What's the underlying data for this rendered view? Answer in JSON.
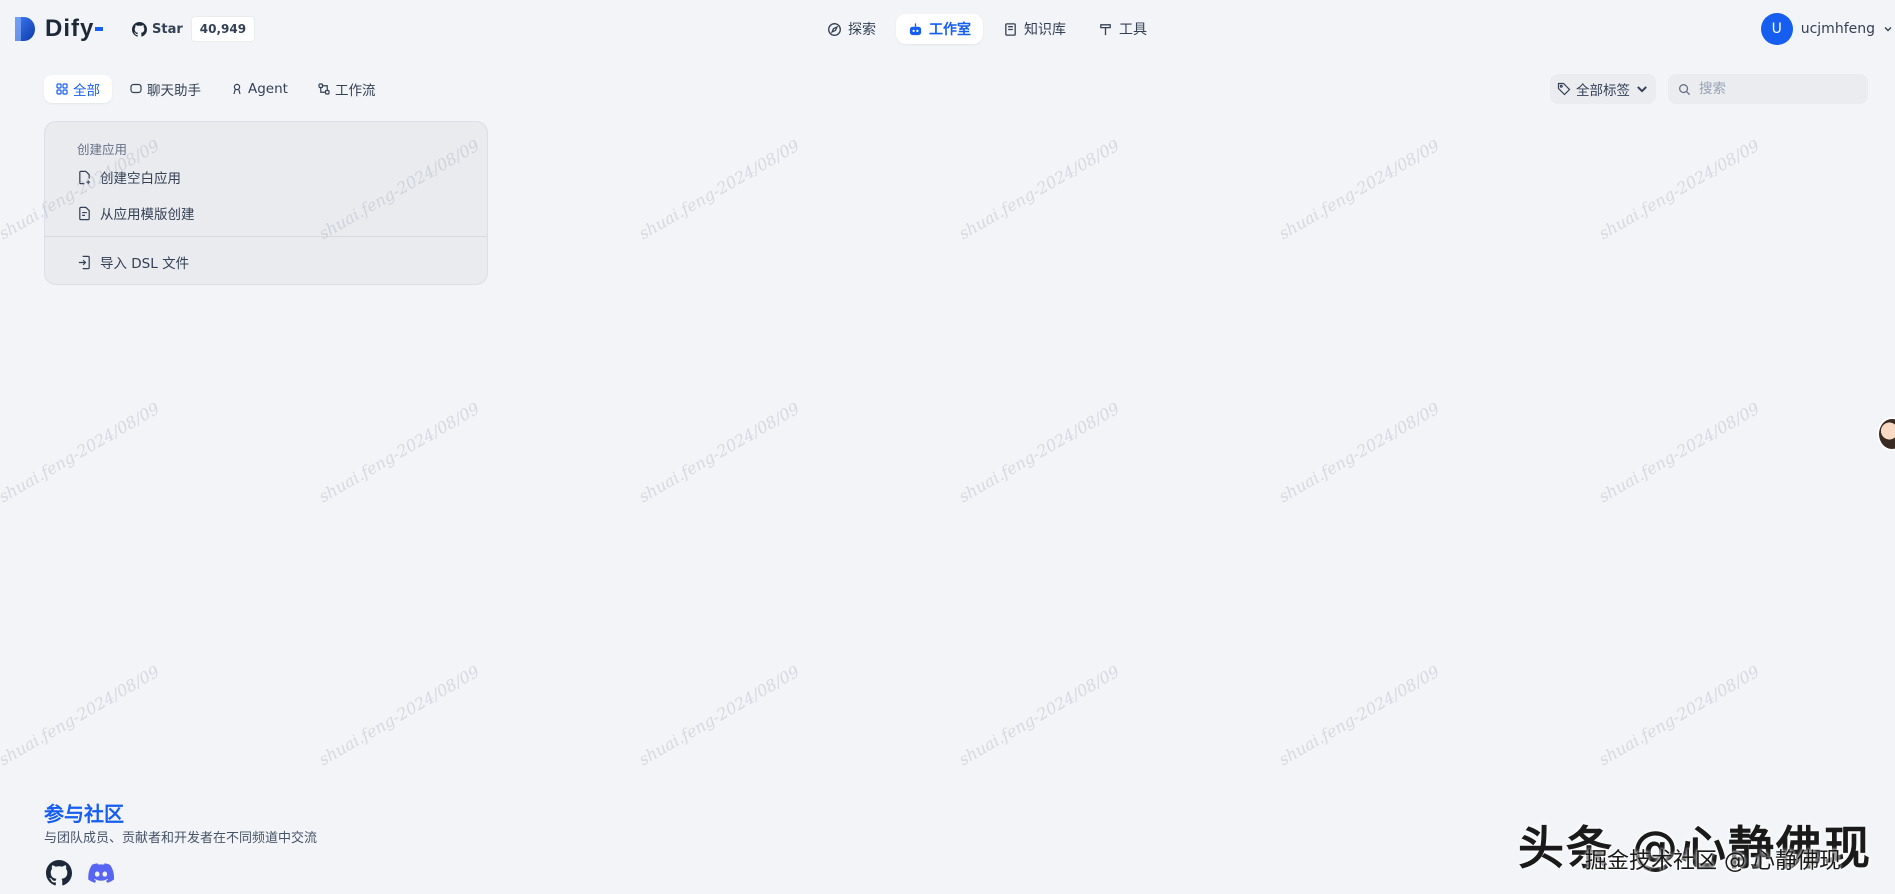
{
  "brand": {
    "name": "Dify"
  },
  "github": {
    "label": "Star",
    "count": "40,949"
  },
  "nav": {
    "items": [
      {
        "label": "探索",
        "icon": "compass-icon",
        "active": false
      },
      {
        "label": "工作室",
        "icon": "robot-icon",
        "active": true
      },
      {
        "label": "知识库",
        "icon": "book-icon",
        "active": false
      },
      {
        "label": "工具",
        "icon": "hammer-icon",
        "active": false
      }
    ]
  },
  "user": {
    "initial": "U",
    "name": "ucjmhfeng"
  },
  "filters": {
    "tabs": [
      {
        "label": "全部",
        "icon": "grid-icon",
        "active": true
      },
      {
        "label": "聊天助手",
        "icon": "chat-bubble-icon",
        "active": false
      },
      {
        "label": "Agent",
        "icon": "agent-icon",
        "active": false
      },
      {
        "label": "工作流",
        "icon": "workflow-icon",
        "active": false
      }
    ],
    "tag_filter_label": "全部标签",
    "search_placeholder": "搜索"
  },
  "create_card": {
    "title": "创建应用",
    "actions": {
      "blank": "创建空白应用",
      "template": "从应用模版创建",
      "import_dsl": "导入 DSL 文件"
    }
  },
  "community": {
    "title": "参与社区",
    "description": "与团队成员、贡献者和开发者在不同频道中交流",
    "icons": [
      "github-icon",
      "discord-icon"
    ]
  },
  "watermark": {
    "text": "shuai.feng-2024/08/09",
    "corner_text": "头条 @心静佛现",
    "corner_subtext": "掘金技术社区 @ 心静佛现"
  },
  "colors": {
    "accent": "#155eef",
    "background": "#f2f4f7"
  }
}
